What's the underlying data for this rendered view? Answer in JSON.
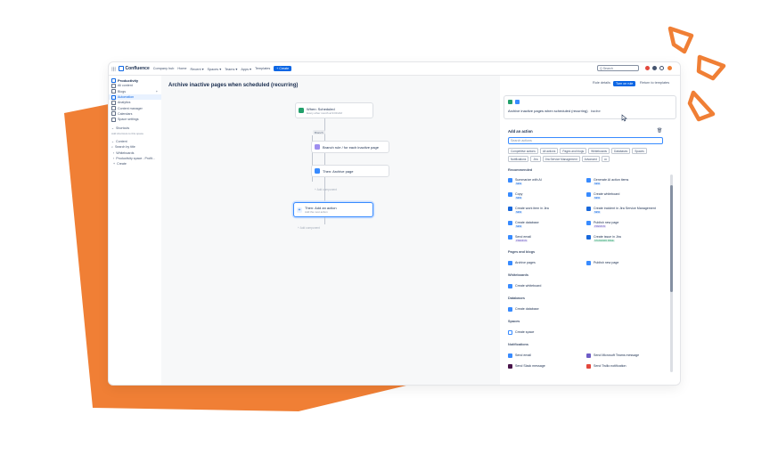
{
  "colors": {
    "accent": "#0c66e4",
    "orange": "#f07f35",
    "selected": "#388bff"
  },
  "topbar": {
    "product": "Confluence",
    "nav": [
      "Company hub",
      "Home",
      "Recent ▾",
      "Spaces ▾",
      "Teams ▾",
      "Apps ▾",
      "Templates"
    ],
    "create_label": "+ Create",
    "search_placeholder": "Q  Search"
  },
  "sidebar": {
    "space_name": "Productivity",
    "items": [
      {
        "label": "All content",
        "icon": "pages-icon"
      },
      {
        "label": "Blogs",
        "icon": "blog-icon",
        "trailing": "+"
      },
      {
        "label": "Automation",
        "icon": "automation-icon",
        "active": true
      },
      {
        "label": "Analytics",
        "icon": "analytics-icon"
      },
      {
        "label": "Content manager",
        "icon": "content-manager-icon"
      },
      {
        "label": "Calendars",
        "icon": "calendar-icon"
      },
      {
        "label": "Space settings",
        "icon": "settings-icon"
      }
    ],
    "shortcuts_label": "Shortcuts",
    "shortcuts_hint": "Add shortcuts to this space",
    "content_label": "Content",
    "filter_placeholder": "Search by title",
    "tree": [
      "Whiteboards",
      "Productivity space - Profit...",
      "Create"
    ]
  },
  "canvas": {
    "title": "Archive inactive pages when scheduled (recurring)",
    "title_menu": "•••",
    "trigger": {
      "title": "When: Scheduled",
      "sub": "Every other month at 9:00 AM"
    },
    "branch_pill": "Branch",
    "step1": "Branch rule / for each inactive page",
    "step2": "Then: Archive page",
    "add_component_inner": "+ Add component",
    "action": {
      "title": "Then: Add an action",
      "sub": "Add the next action"
    },
    "add_component_outer": "+ Add component"
  },
  "toolbar": {
    "rule_details": "Rule details",
    "turn_on": "Turn on rule",
    "return": "Return to templates"
  },
  "rule_card": {
    "title": "Archive inactive pages when scheduled (recurring)",
    "chip": "Inactive"
  },
  "actions": {
    "heading": "Add an action",
    "search_placeholder": "Search actions",
    "chips": [
      "Competitive actions",
      "All actions",
      "Pages and blogs",
      "Whiteboards",
      "Databases",
      "Spaces",
      "Notifications",
      "Jira",
      "Jira Service Management",
      "Advanced",
      "•••"
    ],
    "recommended_label": "Recommended",
    "recommended": [
      {
        "label": "Summarize with AI",
        "tag": "NEW",
        "tag_color": "#0c66e4",
        "icon_color": "#388bff"
      },
      {
        "label": "Generate AI action items",
        "tag": "NEW",
        "tag_color": "#0c66e4",
        "icon_color": "#388bff"
      },
      {
        "label": "Copy",
        "tag": "NEW",
        "tag_color": "#0c66e4",
        "icon_color": "#388bff"
      },
      {
        "label": "Create whiteboard",
        "tag": "NEW",
        "tag_color": "#0c66e4",
        "icon_color": "#388bff"
      },
      {
        "label": "Create work item in Jira",
        "tag": "NEW",
        "tag_color": "#0c66e4",
        "icon_color": "#1868db"
      },
      {
        "label": "Create incident in Jira Service Management",
        "tag": "NEW",
        "tag_color": "#0c66e4",
        "icon_color": "#1868db"
      },
      {
        "label": "Create database",
        "tag": "NEW",
        "tag_color": "#0c66e4",
        "icon_color": "#388bff"
      },
      {
        "label": "Publish new page",
        "tag": "PREMIUM",
        "tag_color": "#6e5dc6",
        "icon_color": "#388bff"
      },
      {
        "label": "Send email",
        "tag": "PREMIUM",
        "tag_color": "#6e5dc6",
        "icon_color": "#388bff"
      },
      {
        "label": "Create issue in Jira",
        "tag": "STANDARD FREE",
        "tag_color": "#22a06b",
        "icon_color": "#1868db"
      }
    ],
    "pages_label": "Pages and blogs",
    "pages": [
      "Archive pages",
      "Publish new page"
    ],
    "whiteboards_label": "Whiteboards",
    "whiteboards": [
      "Create whiteboard"
    ],
    "databases_label": "Databases",
    "databases": [
      "Create database"
    ],
    "spaces_label": "Spaces",
    "spaces": [
      "Create space"
    ],
    "notifications_label": "Notifications",
    "notifications": [
      "Send email",
      "Send Microsoft Teams message",
      "Send Slack message",
      "Send Twilio notification"
    ]
  }
}
